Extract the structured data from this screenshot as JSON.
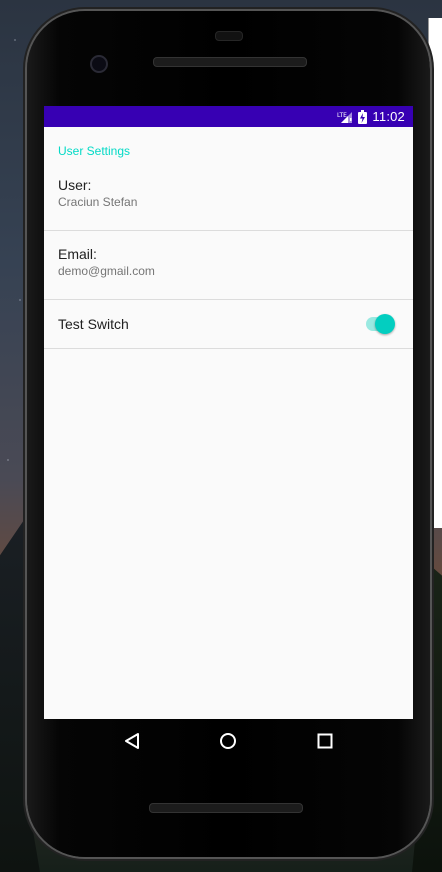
{
  "status_bar": {
    "time": "11:02",
    "signal_icon": "signal-icon",
    "battery_icon": "battery-charging-icon",
    "color": "#3700b3"
  },
  "settings": {
    "category_title": "User Settings",
    "accent_color": "#03dac6",
    "user": {
      "title": "User:",
      "summary": "Craciun Stefan"
    },
    "email": {
      "title": "Email:",
      "summary": "demo@gmail.com"
    },
    "test_switch": {
      "title": "Test Switch",
      "checked": true
    }
  },
  "nav_bar": {
    "back_icon": "back-icon",
    "home_icon": "home-icon",
    "recents_icon": "recents-icon"
  }
}
